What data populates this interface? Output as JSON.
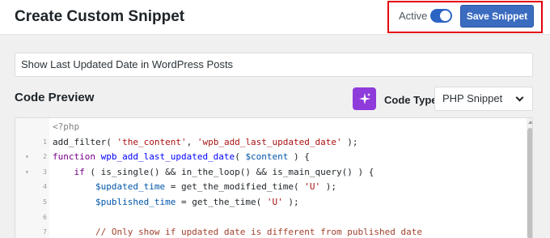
{
  "header": {
    "title": "Create Custom Snippet",
    "active_label": "Active",
    "active_on": true,
    "save_label": "Save Snippet"
  },
  "snippet": {
    "title_value": "Show Last Updated Date in WordPress Posts"
  },
  "code_preview": {
    "label": "Code Preview",
    "ai_icon": "sparkle-icon",
    "code_type_label": "Code Type",
    "code_type_value": "PHP Snippet"
  },
  "editor": {
    "lines": [
      {
        "num": "",
        "fold": "",
        "text": "<?php"
      },
      {
        "num": "1",
        "fold": "",
        "text": "add_filter( 'the_content', 'wpb_add_last_updated_date' );"
      },
      {
        "num": "2",
        "fold": "▾",
        "text": "function wpb_add_last_updated_date( $content ) {"
      },
      {
        "num": "3",
        "fold": "▾",
        "text": "    if ( is_single() && in_the_loop() && is_main_query() ) {"
      },
      {
        "num": "4",
        "fold": "",
        "text": "        $updated_time = get_the_modified_time( 'U' );"
      },
      {
        "num": "5",
        "fold": "",
        "text": "        $published_time = get_the_time( 'U' );"
      },
      {
        "num": "6",
        "fold": "",
        "text": ""
      },
      {
        "num": "7",
        "fold": "",
        "text": "        // Only show if updated date is different from published date"
      }
    ]
  },
  "colors": {
    "accent": "#3b6cc0",
    "highlight": "#e3000f",
    "ai_button": "#8f3bdb"
  }
}
